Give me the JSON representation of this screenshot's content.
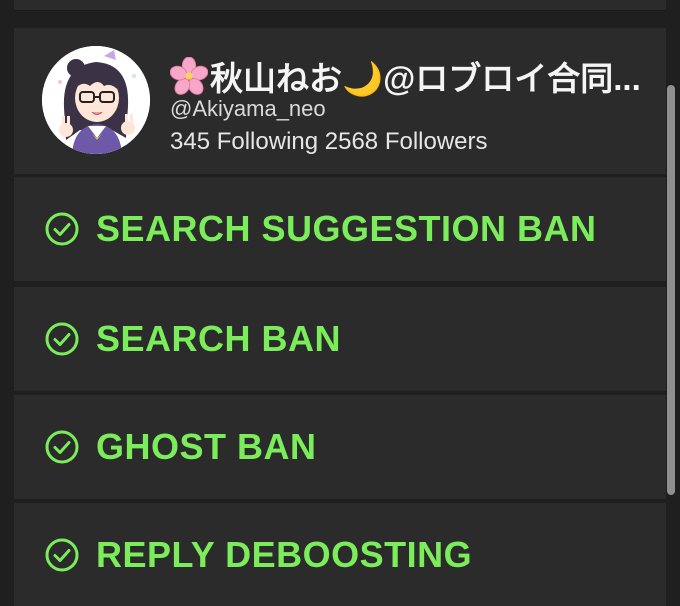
{
  "profile": {
    "display_name": "秋山ねお🌙@ロブロイ合同...",
    "handle": "@Akiyama_neo",
    "stats": "345 Following 2568 Followers",
    "avatar_icon": "avatar-illustration",
    "flower_icon": "cherry-blossom-icon"
  },
  "checks": [
    {
      "label": "SEARCH SUGGESTION BAN",
      "icon": "check-circle-icon",
      "state": "passed"
    },
    {
      "label": "SEARCH BAN",
      "icon": "check-circle-icon",
      "state": "passed"
    },
    {
      "label": "GHOST BAN",
      "icon": "check-circle-icon",
      "state": "passed"
    },
    {
      "label": "REPLY DEBOOSTING",
      "icon": "check-circle-icon",
      "state": "passed"
    }
  ],
  "colors": {
    "background": "#1f1f1f",
    "card": "#2b2b2b",
    "pass_green": "#7bec5a",
    "text": "#f5f5f5"
  }
}
